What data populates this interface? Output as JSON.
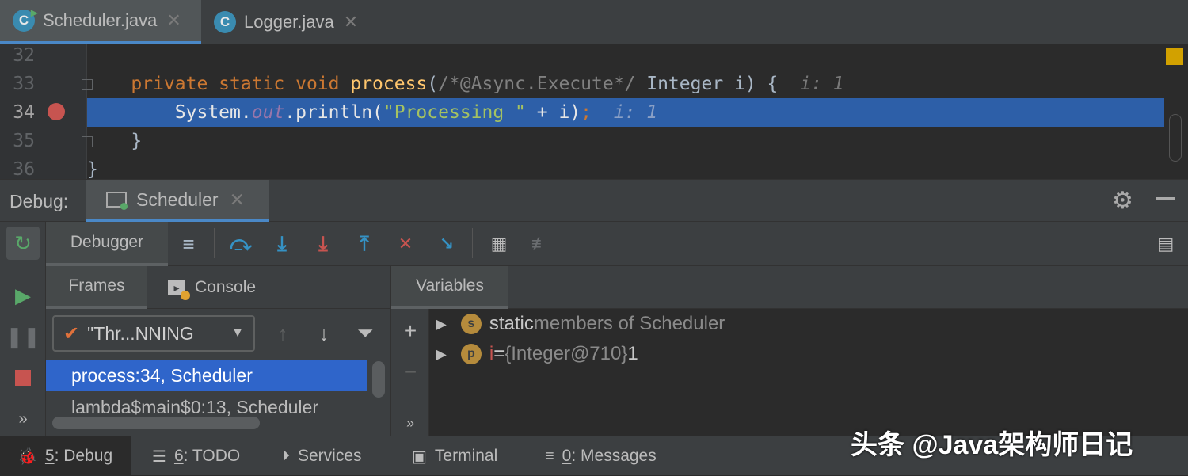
{
  "tabs": [
    {
      "label": "Scheduler.java",
      "icon": "C",
      "active": true
    },
    {
      "label": "Logger.java",
      "icon": "C",
      "active": false
    }
  ],
  "editor": {
    "line_numbers": [
      "32",
      "33",
      "34",
      "35",
      "36"
    ],
    "current_line": "34",
    "lines": {
      "l33": {
        "kw1": "private static void ",
        "fn": "process",
        "p1": "(",
        "cm": "/*@Async.Execute*/",
        "p2": " Integer i) {",
        "hint": "i: 1"
      },
      "l34": {
        "p1": "System.",
        "fld": "out",
        "p2": ".println(",
        "str": "\"Processing \"",
        "p3": " + i)",
        "semi": ";",
        "hint": "i: 1"
      },
      "l35": "}",
      "l36": "}"
    }
  },
  "debug": {
    "label": "Debug:",
    "session_tab": "Scheduler",
    "toolbar_tab": "Debugger"
  },
  "frames": {
    "tab_frames": "Frames",
    "tab_console": "Console",
    "thread": "\"Thr...NNING",
    "list": [
      "process:34, Scheduler",
      "lambda$main$0:13, Scheduler"
    ]
  },
  "variables": {
    "tab": "Variables",
    "rows": [
      {
        "badge": "s",
        "name": "static",
        "rest": " members of Scheduler"
      },
      {
        "badge": "p",
        "name": "i",
        "eq": " = ",
        "type": "{Integer@710}",
        "value": " 1"
      }
    ]
  },
  "statusbar": {
    "items": [
      {
        "key": "5",
        "label": ": Debug"
      },
      {
        "key": "6",
        "label": ": TODO"
      },
      {
        "key": "",
        "label": "Services"
      },
      {
        "key": "",
        "label": "Terminal"
      },
      {
        "key": "0",
        "label": ": Messages"
      }
    ]
  },
  "watermark": "头条 @Java架构师日记",
  "colors": {
    "accent": "#4a88c7",
    "selection": "#2f65ca",
    "keyword": "#cc7832",
    "function": "#ffc66d",
    "string": "#6a8759",
    "breakpoint": "#c75450"
  }
}
